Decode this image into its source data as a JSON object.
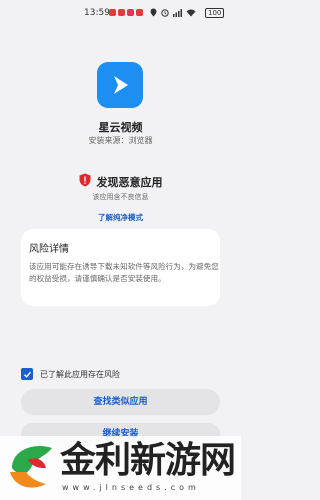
{
  "status_bar": {
    "time": "13:59",
    "battery": "100"
  },
  "app": {
    "name": "星云视频",
    "install_source": "安装来源：浏览器"
  },
  "warning": {
    "title": "发现恶意应用",
    "subtitle": "该应用含不良信息",
    "link": "了解纯净模式"
  },
  "risk": {
    "title": "风险详情",
    "description": "该应用可能存在诱导下载未知软件等风险行为，为避免您的权益受损，请谨慎确认是否安装使用。"
  },
  "consent": {
    "label": "已了解此应用存在风险",
    "checked": true
  },
  "buttons": {
    "find_similar": "查找类似应用",
    "continue_install": "继续安装"
  },
  "watermark": {
    "brand": "金利新游网",
    "url": "www.jlnseeds.com"
  },
  "colors": {
    "accent": "#1a5fcf",
    "app_icon": "#1d8ff2",
    "warning_red": "#e0282e"
  }
}
